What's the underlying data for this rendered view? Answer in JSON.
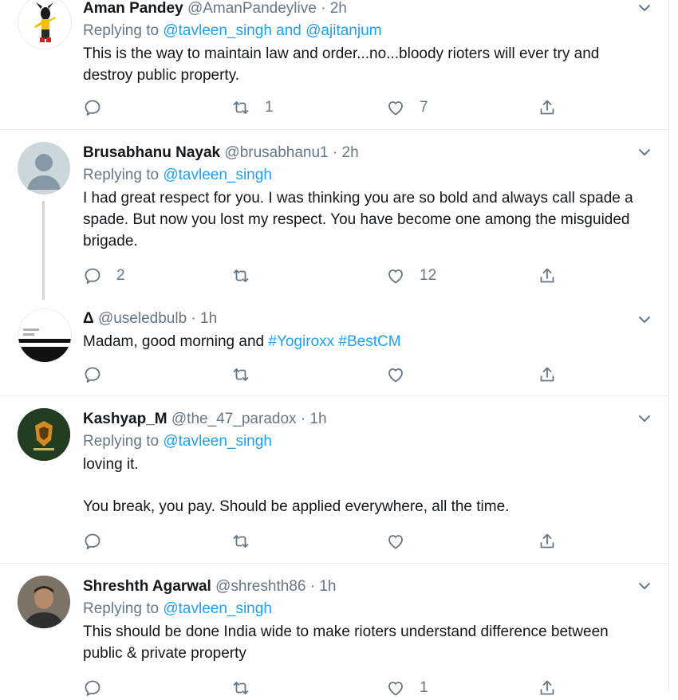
{
  "tweets": [
    {
      "name": "Aman Pandey",
      "handle": "@AmanPandeylive",
      "time": "2h",
      "replying_prefix": "Replying to",
      "replying_to": "@tavleen_singh and @ajitanjum",
      "text": "This is the way to maintain law and order...no...bloody rioters will ever try and destroy public property.",
      "counts": {
        "reply": "",
        "retweet": "1",
        "like": "7"
      }
    },
    {
      "name": "Brusabhanu Nayak",
      "handle": "@brusabhanu1",
      "time": "2h",
      "replying_prefix": "Replying to",
      "replying_to": "@tavleen_singh",
      "text": "I had great respect for you. I was thinking you are so bold and always call spade a spade. But now you lost my respect. You have become one among the misguided brigade.",
      "counts": {
        "reply": "2",
        "retweet": "",
        "like": "12"
      }
    },
    {
      "name": "Δ",
      "handle": "@useledbulb",
      "time": "1h",
      "text_plain": "Madam, good morning and",
      "hashtags": "#Yogiroxx #BestCM",
      "counts": {
        "reply": "",
        "retweet": "",
        "like": ""
      }
    },
    {
      "name": "Kashyap_M",
      "handle": "@the_47_paradox",
      "time": "1h",
      "replying_prefix": "Replying to",
      "replying_to": "@tavleen_singh",
      "text_line1": "loving it.",
      "text_line2": "You break, you pay. Should be applied everywhere, all the time.",
      "counts": {
        "reply": "",
        "retweet": "",
        "like": ""
      }
    },
    {
      "name": "Shreshth Agarwal",
      "handle": "@shreshth86",
      "time": "1h",
      "replying_prefix": "Replying to",
      "replying_to": "@tavleen_singh",
      "text": "This should be done India wide to make rioters understand difference between public & private property",
      "counts": {
        "reply": "",
        "retweet": "",
        "like": "1"
      }
    }
  ],
  "separator": "·",
  "colors": {
    "link": "#1da1f2",
    "muted": "#657786",
    "text": "#14171a",
    "border": "#e6ecf0"
  },
  "icons": {
    "reply": "reply-icon",
    "retweet": "retweet-icon",
    "like": "like-icon",
    "share": "share-icon",
    "more": "chevron-down-icon"
  }
}
